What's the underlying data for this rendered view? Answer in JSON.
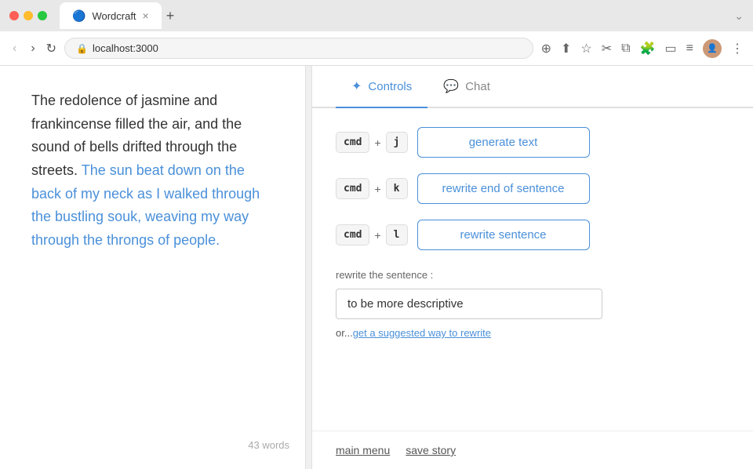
{
  "browser": {
    "tab_title": "Wordcraft",
    "url": "localhost:3000",
    "tab_close": "×",
    "tab_new": "+"
  },
  "nav": {
    "back": "‹",
    "forward": "›",
    "refresh": "↻",
    "more": "⋮",
    "chevron": "⌄"
  },
  "panel_tabs": [
    {
      "id": "controls",
      "label": "Controls",
      "active": true
    },
    {
      "id": "chat",
      "label": "Chat",
      "active": false
    }
  ],
  "controls": {
    "shortcut1": {
      "mod": "cmd",
      "key": "j",
      "label": "generate text"
    },
    "shortcut2": {
      "mod": "cmd",
      "key": "k",
      "label": "rewrite end of sentence"
    },
    "shortcut3": {
      "mod": "cmd",
      "key": "l",
      "label": "rewrite sentence"
    },
    "rewrite_label": "rewrite the sentence :",
    "rewrite_placeholder": "to be more descriptive",
    "rewrite_value": "to be more descriptive",
    "or_text": "or...",
    "suggest_link": "get a suggested way to rewrite"
  },
  "footer": {
    "main_menu": "main menu",
    "save_story": "save story"
  },
  "editor": {
    "text_before": "The redolence of jasmine and frankincense filled the air, and the sound of bells drifted through the streets.",
    "text_selected": "The sun beat down on the back of my neck as I walked through the bustling souk, weaving my way through the throngs of people.",
    "word_count": "43 words"
  }
}
